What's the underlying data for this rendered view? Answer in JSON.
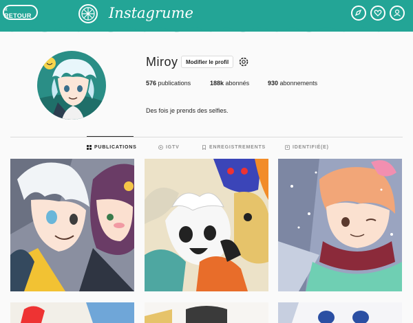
{
  "header": {
    "back_label": "« RETOUR",
    "app_title": "Instagrume",
    "nav_icons": [
      "explore-icon",
      "heart-icon",
      "profile-icon"
    ]
  },
  "profile": {
    "username": "Miroy",
    "edit_label": "Modifier le profil",
    "stats": {
      "posts_count": "576",
      "posts_label": "publications",
      "followers_count": "188k",
      "followers_label": "abonnés",
      "following_count": "930",
      "following_label": "abonnements"
    },
    "bio": "Des fois je prends des selfies."
  },
  "tabs": [
    {
      "label": "PUBLICATIONS",
      "icon": "grid-icon",
      "active": true
    },
    {
      "label": "IGTV",
      "icon": "tv-icon",
      "active": false
    },
    {
      "label": "ENREGISTREMENTS",
      "icon": "bookmark-icon",
      "active": false
    },
    {
      "label": "IDENTIFIÉ(E)",
      "icon": "tag-icon",
      "active": false
    }
  ],
  "colors": {
    "brand_teal": "#23a596",
    "text": "#262626",
    "muted": "#8e8e8e",
    "border": "#dbdbdb",
    "background": "#fafafa"
  }
}
